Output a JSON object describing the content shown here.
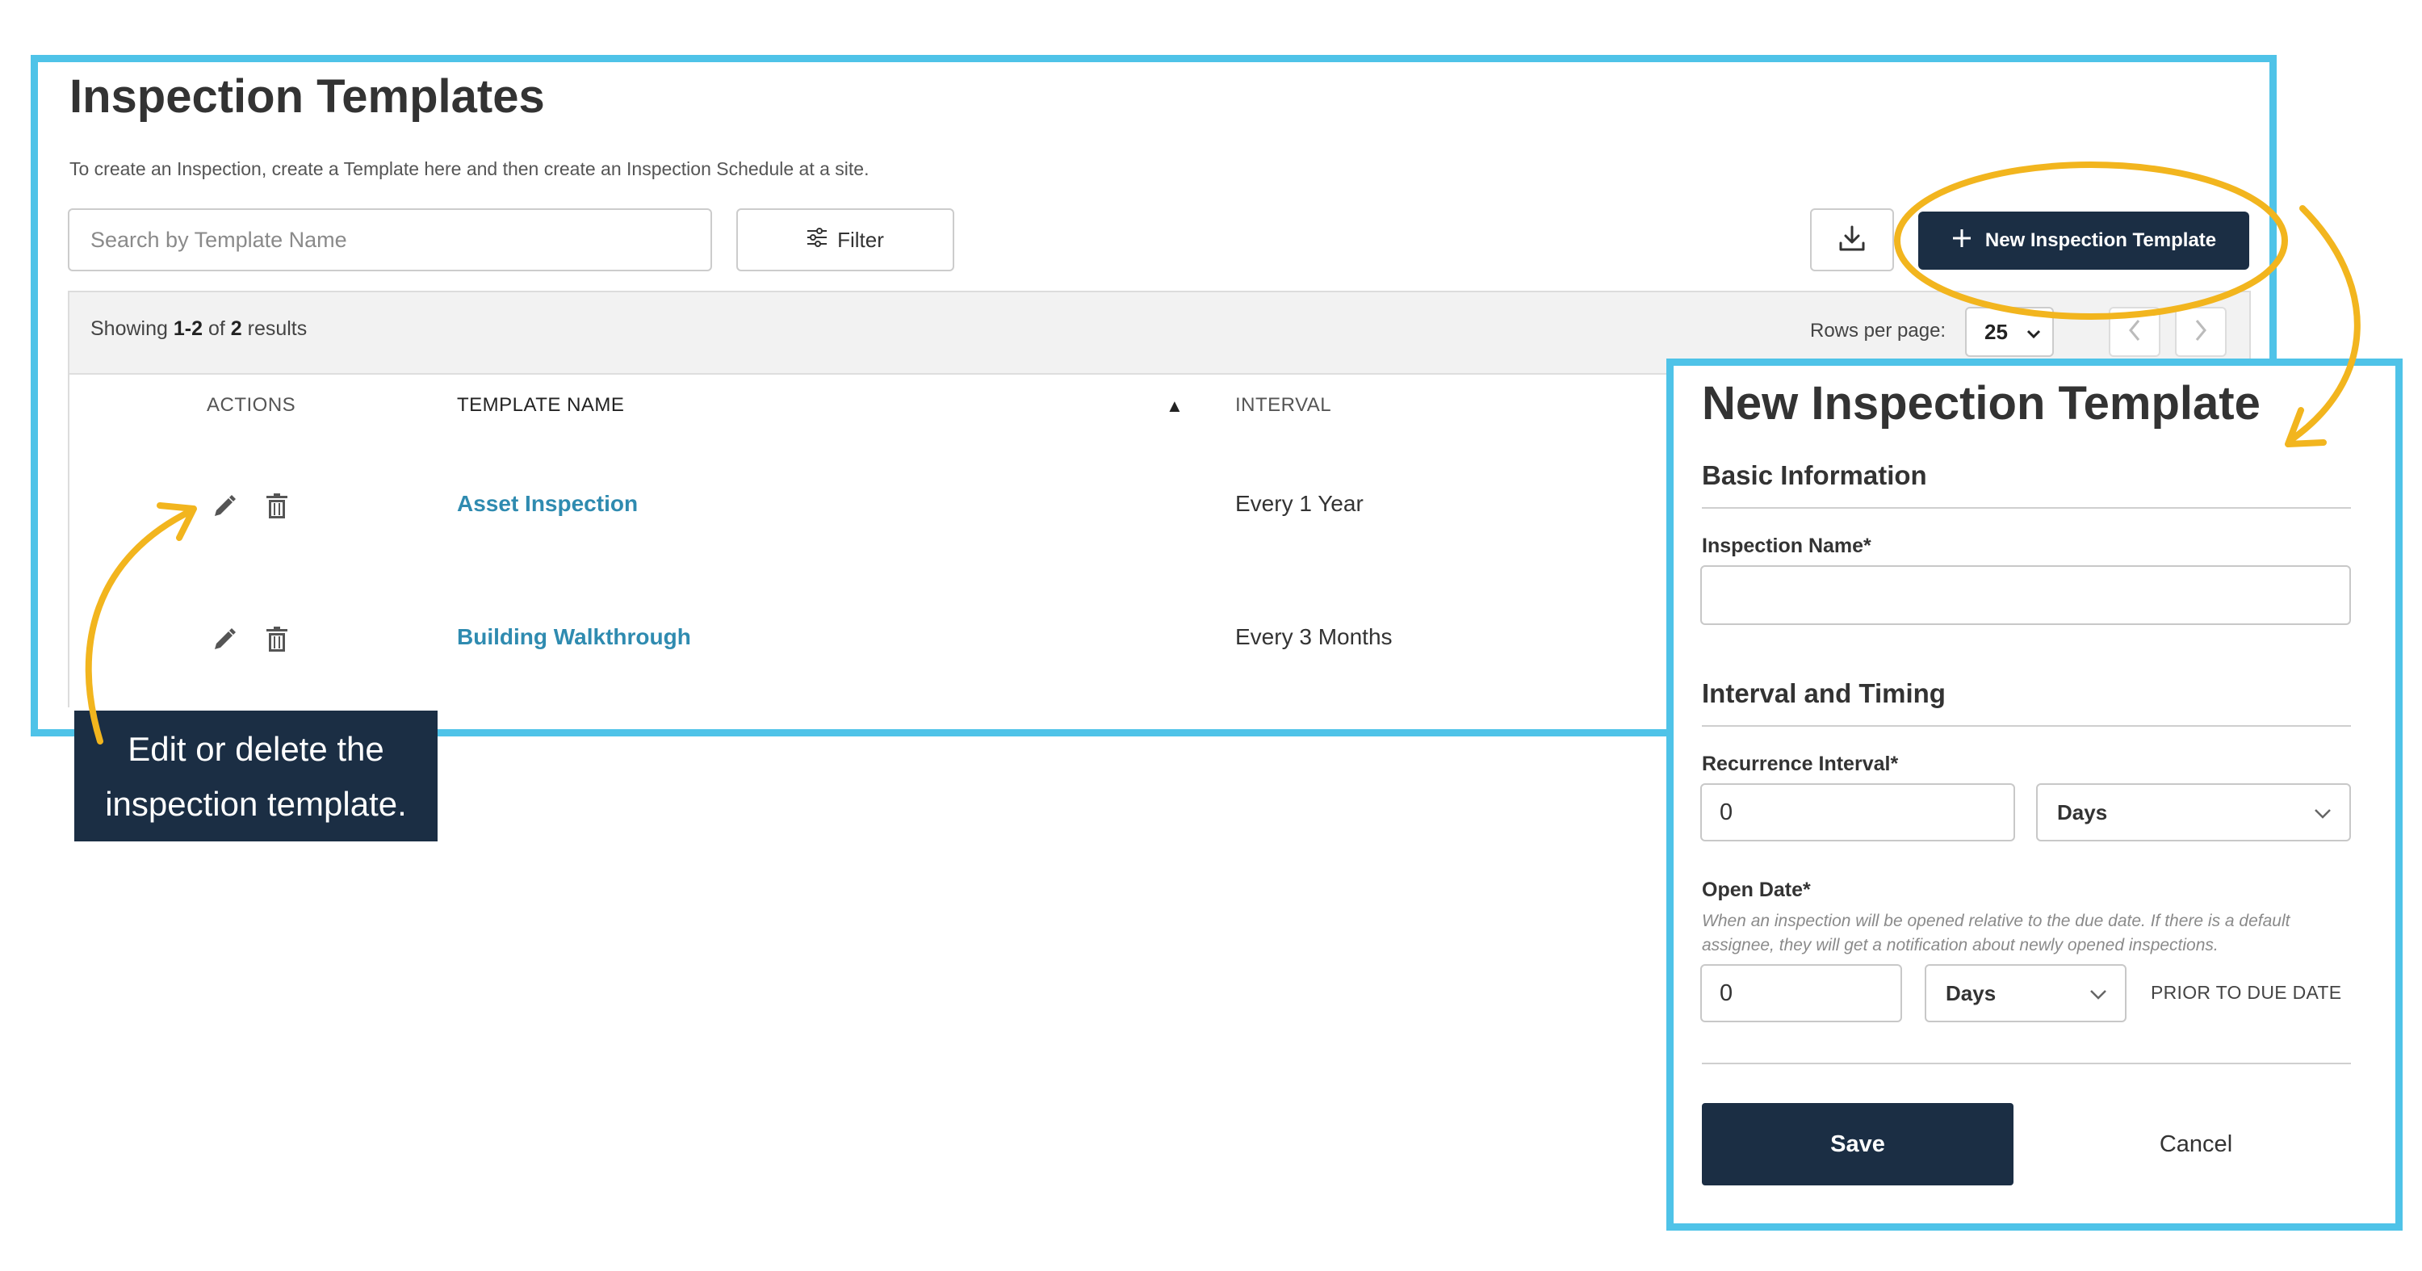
{
  "page": {
    "title": "Inspection Templates",
    "subtitle": "To create an Inspection, create a Template here and then create an Inspection Schedule at a site."
  },
  "toolbar": {
    "search_placeholder": "Search by Template Name",
    "filter_label": "Filter",
    "download_icon": "download-icon",
    "new_template_label": "New Inspection Template"
  },
  "table": {
    "showing_prefix": "Showing",
    "showing_range": "1-2",
    "showing_of": "of",
    "showing_total": "2",
    "showing_suffix": "results",
    "rows_per_page_label": "Rows per page:",
    "rows_per_page_value": "25",
    "columns": {
      "actions": "ACTIONS",
      "template_name": "TEMPLATE NAME",
      "sort_indicator": "▲",
      "interval": "INTERVAL"
    },
    "rows": [
      {
        "name": "Asset Inspection",
        "interval": "Every 1 Year"
      },
      {
        "name": "Building Walkthrough",
        "interval": "Every 3 Months"
      }
    ]
  },
  "callout": {
    "line1": "Edit or delete the",
    "line2": "inspection template."
  },
  "modal": {
    "title": "New Inspection Template",
    "basic_info_title": "Basic Information",
    "inspection_name_label": "Inspection Name*",
    "inspection_name_value": "",
    "interval_title": "Interval and Timing",
    "recurrence_label": "Recurrence Interval*",
    "recurrence_value": "0",
    "recurrence_unit": "Days",
    "open_date_label": "Open Date*",
    "open_date_help": "When an inspection will be opened relative to the due date. If there is a default assignee, they will get a notification about newly opened inspections.",
    "open_date_value": "0",
    "open_date_unit": "Days",
    "prior_label": "PRIOR TO DUE DATE",
    "save_label": "Save",
    "cancel_label": "Cancel"
  },
  "colors": {
    "frame_highlight": "#4fc3e8",
    "primary_navy": "#1b2e44",
    "link_blue": "#2f8bb0",
    "annotation_gold": "#f2b51e"
  }
}
